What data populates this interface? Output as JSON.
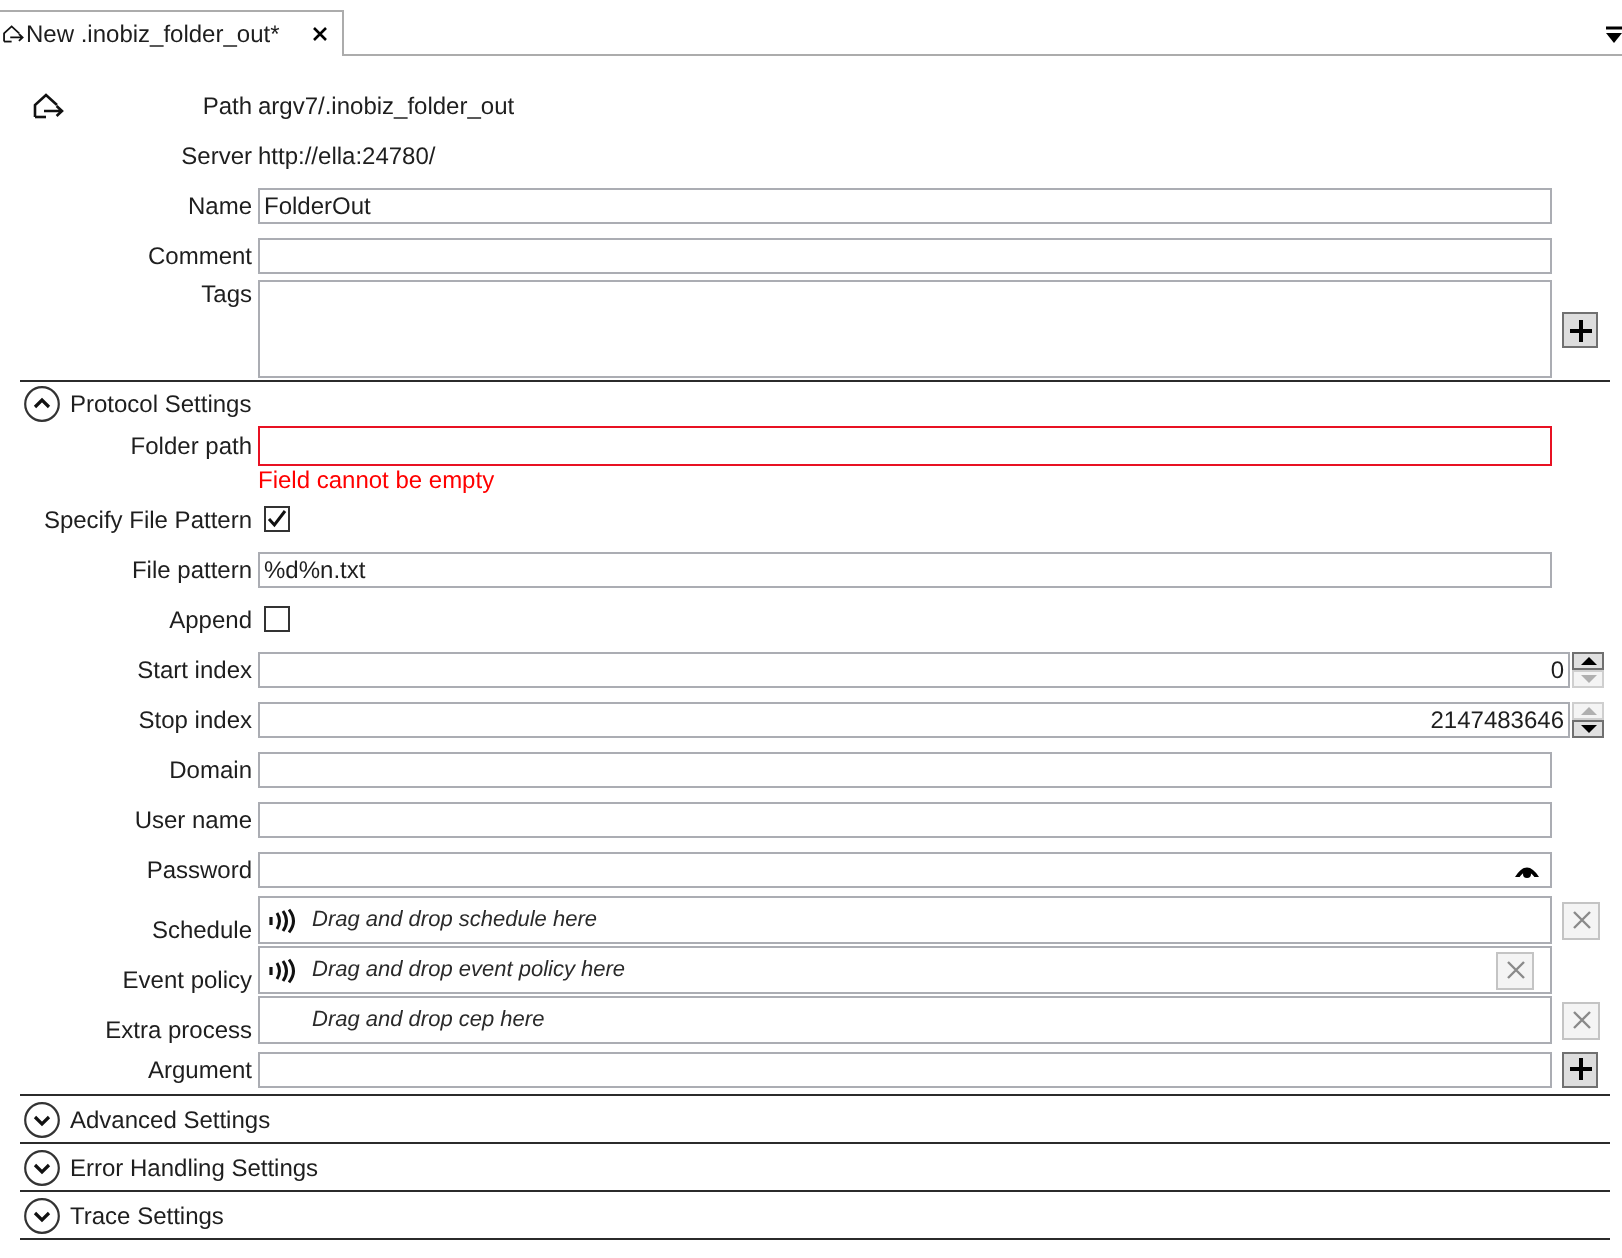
{
  "tab": {
    "title": "New .inobiz_folder_out*",
    "selected": true
  },
  "header_fields": [
    {
      "kind": "info",
      "label": "Path",
      "value": "argv7/.inobiz_folder_out"
    },
    {
      "kind": "info",
      "label": "Server",
      "value": "http://ella:24780/"
    },
    {
      "kind": "text",
      "label": "Name",
      "value": "FolderOut"
    },
    {
      "kind": "text",
      "label": "Comment"
    },
    {
      "kind": "tags",
      "label": "Tags"
    }
  ],
  "sections": [
    {
      "title": "Protocol Settings",
      "expanded": true,
      "fields": [
        {
          "kind": "text",
          "label": "Folder path",
          "error": "Field cannot be empty"
        },
        {
          "kind": "checkbox",
          "label": "Specify File Pattern",
          "checked": true
        },
        {
          "kind": "text",
          "label": "File pattern",
          "value": "%d%n.txt"
        },
        {
          "kind": "checkbox",
          "label": "Append",
          "checked": false
        },
        {
          "kind": "number",
          "label": "Start index",
          "value": "0",
          "can_increase": true,
          "can_decrease": false
        },
        {
          "kind": "number",
          "label": "Stop index",
          "value": "2147483646",
          "can_increase": false,
          "can_decrease": true
        },
        {
          "kind": "text",
          "label": "Domain"
        },
        {
          "kind": "text",
          "label": "User name"
        },
        {
          "kind": "password",
          "label": "Password"
        },
        {
          "kind": "drop",
          "label": "Schedule",
          "placeholder": "Drag and drop schedule here",
          "has_icon": true,
          "clear_inside": false
        },
        {
          "kind": "drop",
          "label": "Event policy",
          "placeholder": "Drag and drop event policy here",
          "has_icon": true,
          "clear_inside": true
        },
        {
          "kind": "drop",
          "label": "Extra process",
          "placeholder": "Drag and drop cep here",
          "has_icon": false,
          "clear_inside": false
        },
        {
          "kind": "list",
          "label": "Argument"
        }
      ]
    },
    {
      "title": "Advanced Settings",
      "expanded": false
    },
    {
      "title": "Error Handling Settings",
      "expanded": false
    },
    {
      "title": "Trace Settings",
      "expanded": false
    }
  ]
}
